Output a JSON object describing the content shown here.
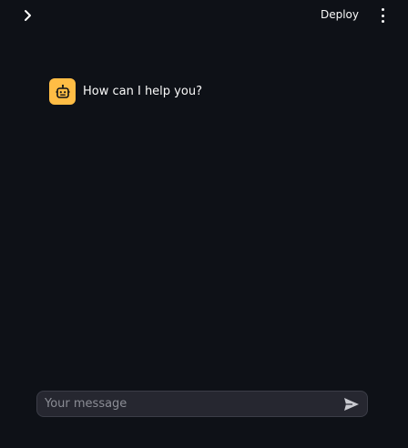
{
  "header": {
    "deploy_label": "Deploy",
    "sidebar_toggle_icon": "chevron-right-icon",
    "menu_icon": "more-vertical-icon"
  },
  "chat": {
    "messages": [
      {
        "role": "assistant",
        "avatar_icon": "robot-icon",
        "text": "How can I help you?"
      }
    ],
    "input": {
      "value": "",
      "placeholder": "Your message",
      "send_icon": "send-icon"
    }
  },
  "colors": {
    "background": "#0e1117",
    "avatar": "#ffbd45",
    "input_bg": "#262730",
    "text": "#fafafa",
    "placeholder": "#8b8d95"
  }
}
